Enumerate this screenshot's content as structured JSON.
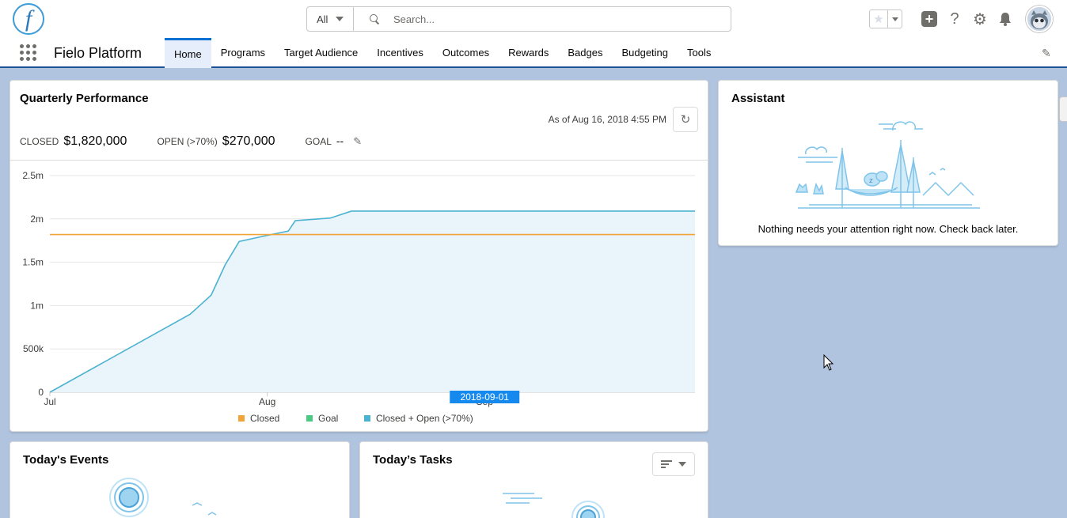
{
  "header": {
    "search_scope": "All",
    "search_placeholder": "Search..."
  },
  "nav": {
    "app_name": "Fielo Platform",
    "tabs": [
      {
        "label": "Home",
        "active": true
      },
      {
        "label": "Programs"
      },
      {
        "label": "Target Audience"
      },
      {
        "label": "Incentives"
      },
      {
        "label": "Outcomes"
      },
      {
        "label": "Rewards"
      },
      {
        "label": "Badges"
      },
      {
        "label": "Budgeting"
      },
      {
        "label": "Tools"
      }
    ]
  },
  "quarterly": {
    "title": "Quarterly Performance",
    "as_of": "As of Aug 16, 2018 4:55 PM",
    "closed_label": "CLOSED",
    "closed_value": "$1,820,000",
    "open_label": "OPEN (>70%)",
    "open_value": "$270,000",
    "goal_label": "GOAL",
    "goal_value": "--"
  },
  "chart_data": {
    "type": "line",
    "ylim": [
      0,
      2500000
    ],
    "y_ticks": [
      "0",
      "500k",
      "1m",
      "1.5m",
      "2m",
      "2.5m"
    ],
    "x_ticks": [
      "Jul",
      "Aug",
      "Sep"
    ],
    "hover_label": "2018-09-01",
    "colors": {
      "closed": "#f2a536",
      "goal": "#4bca81",
      "open": "#4bb2d0"
    },
    "series": [
      {
        "name": "Closed",
        "values": [
          [
            0,
            1820000
          ],
          [
            92,
            1820000
          ]
        ]
      },
      {
        "name": "Goal",
        "values": []
      },
      {
        "name": "Closed + Open (>70%)",
        "values": [
          [
            0,
            0
          ],
          [
            20,
            900000
          ],
          [
            23,
            1120000
          ],
          [
            25,
            1470000
          ],
          [
            27,
            1740000
          ],
          [
            31,
            1810000
          ],
          [
            34,
            1860000
          ],
          [
            35,
            1980000
          ],
          [
            40,
            2010000
          ],
          [
            43,
            2090000
          ],
          [
            92,
            2090000
          ]
        ]
      }
    ],
    "legend": [
      "Closed",
      "Goal",
      "Closed + Open (>70%)"
    ]
  },
  "assistant": {
    "title": "Assistant",
    "message": "Nothing needs your attention right now. Check back later."
  },
  "events": {
    "title": "Today's Events"
  },
  "tasks": {
    "title": "Today’s Tasks"
  }
}
